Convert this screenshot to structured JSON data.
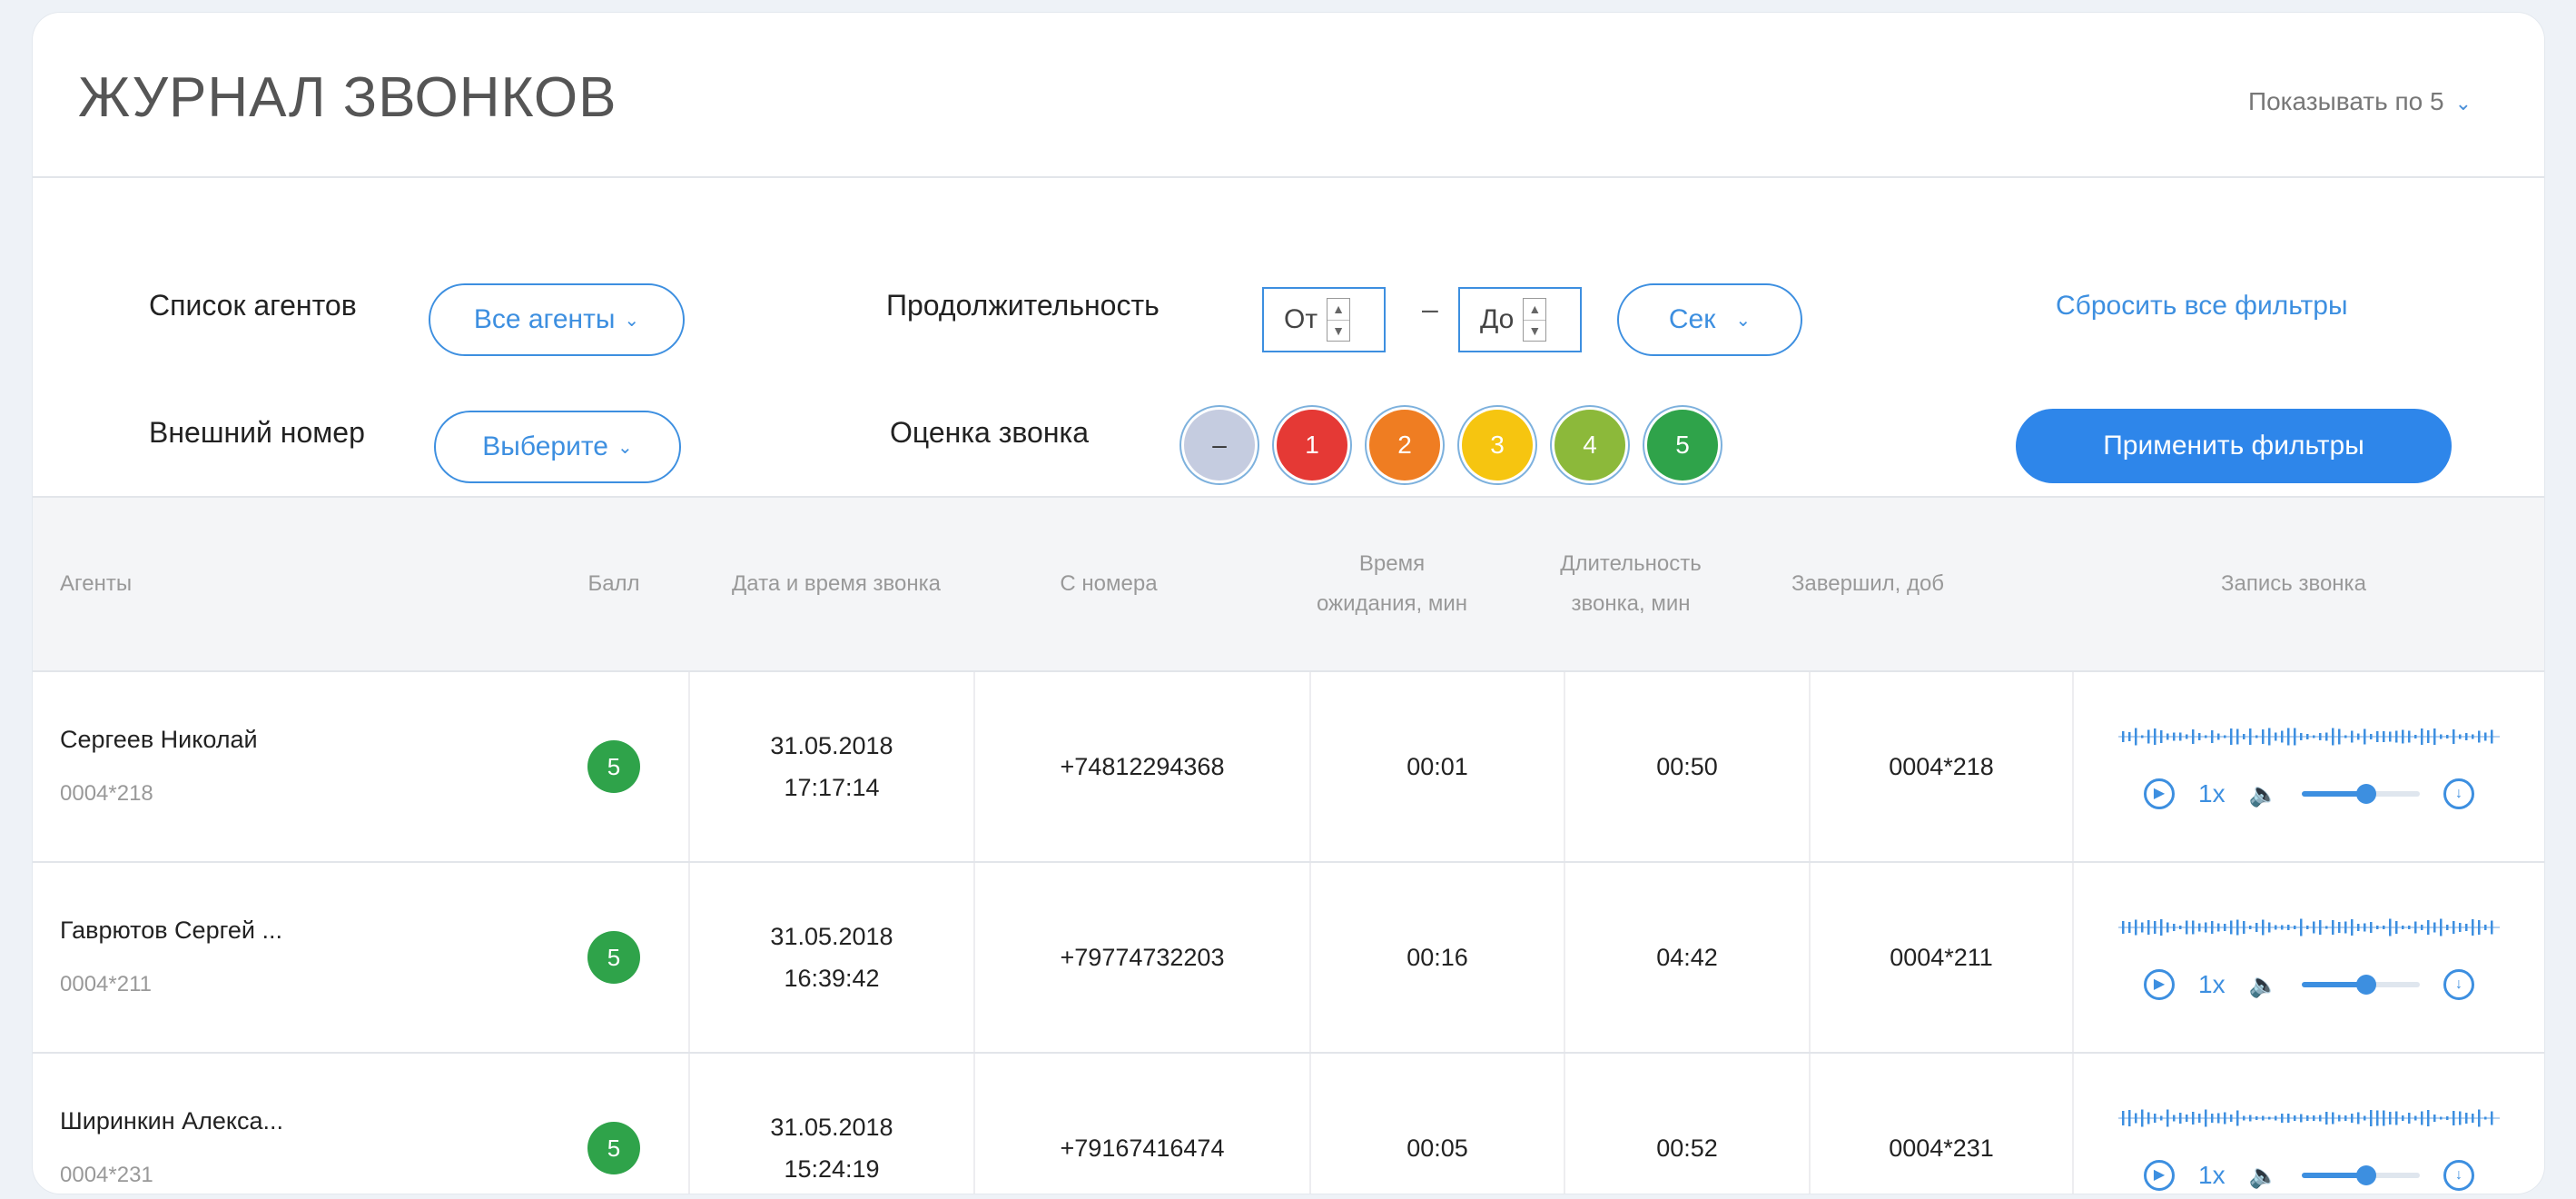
{
  "header": {
    "title": "ЖУРНАЛ ЗВОНКОВ",
    "per_page_label": "Показывать по 5"
  },
  "filters": {
    "agents_label": "Список агентов",
    "agents_value": "Все агенты",
    "external_label": "Внешний номер",
    "external_value": "Выберите",
    "duration_label": "Продолжительность",
    "from_placeholder": "От",
    "to_placeholder": "До",
    "dash": "–",
    "unit_value": "Сек",
    "rating_label": "Оценка звонка",
    "ratings": [
      {
        "label": "–",
        "color": "#c5cce0",
        "text_color": "#333"
      },
      {
        "label": "1",
        "color": "#e53935",
        "text_color": "#fff"
      },
      {
        "label": "2",
        "color": "#ef7d22",
        "text_color": "#fff"
      },
      {
        "label": "3",
        "color": "#f6c510",
        "text_color": "#fff"
      },
      {
        "label": "4",
        "color": "#8cb93a",
        "text_color": "#fff"
      },
      {
        "label": "5",
        "color": "#2fa34a",
        "text_color": "#fff"
      }
    ],
    "reset_label": "Сбросить все фильтры",
    "apply_label": "Применить фильтры"
  },
  "table": {
    "columns": [
      "Агенты",
      "Балл",
      "Дата и время звонка",
      "С номера",
      "Время ожидания, мин",
      "Длительность звонка, мин",
      "Завершил, доб",
      "Запись звонка"
    ],
    "rows": [
      {
        "agent": "Сергеев Николай",
        "ext": "0004*218",
        "score": "5",
        "date": "31.05.2018",
        "time": "17:17:14",
        "from": "+74812294368",
        "wait": "00:01",
        "duration": "00:50",
        "ended": "0004*218",
        "speed": "1x",
        "volume": 0.55
      },
      {
        "agent": "Гаврютов Сергей ...",
        "ext": "0004*211",
        "score": "5",
        "date": "31.05.2018",
        "time": "16:39:42",
        "from": "+79774732203",
        "wait": "00:16",
        "duration": "04:42",
        "ended": "0004*211",
        "speed": "1x",
        "volume": 0.55
      },
      {
        "agent": "Ширинкин Алекса...",
        "ext": "0004*231",
        "score": "5",
        "date": "31.05.2018",
        "time": "15:24:19",
        "from": "+79167416474",
        "wait": "00:05",
        "duration": "00:52",
        "ended": "0004*231",
        "speed": "1x",
        "volume": 0.55
      }
    ]
  },
  "accent_color": "#3d8fe0"
}
